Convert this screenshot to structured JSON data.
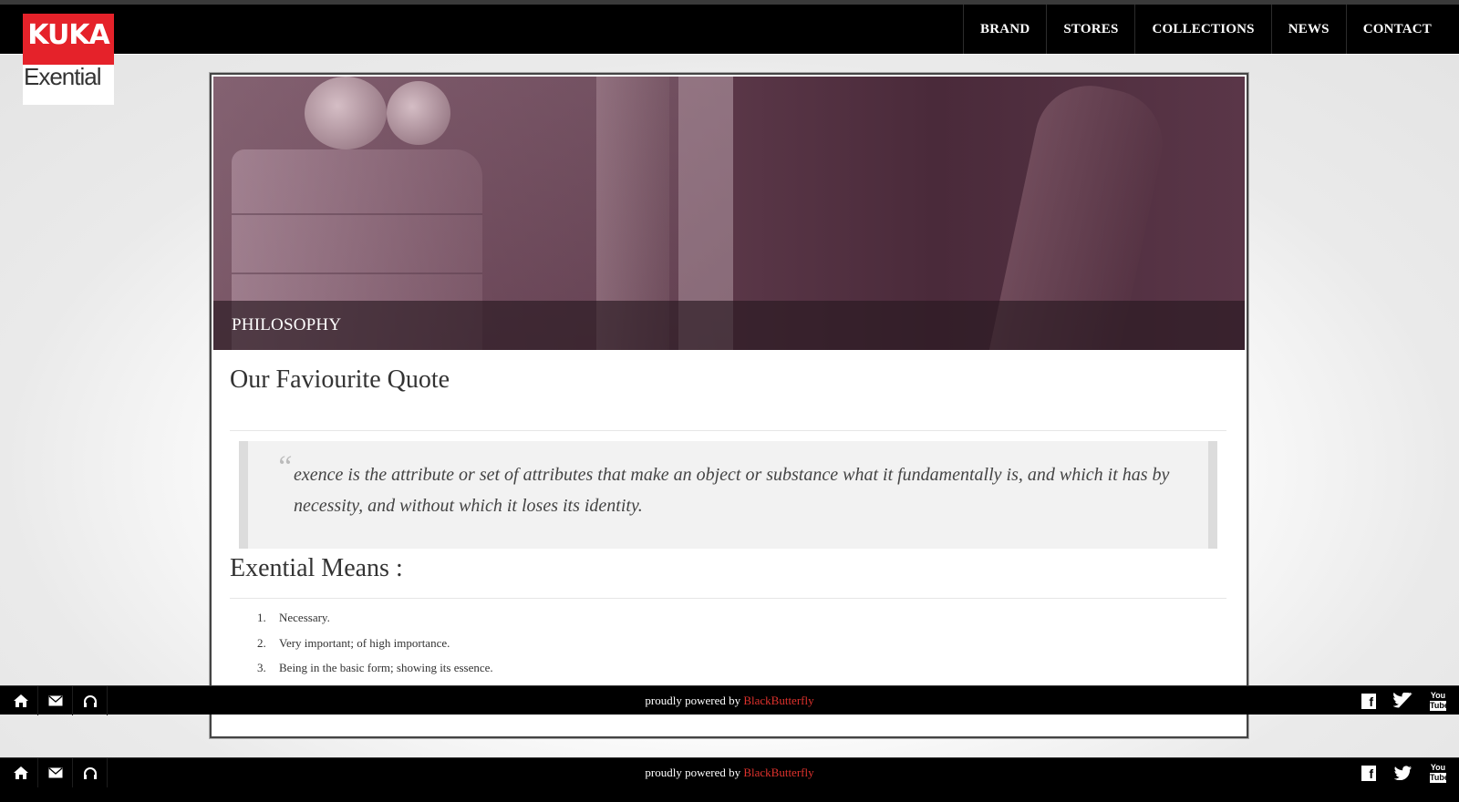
{
  "logo": {
    "top": "KUKA",
    "bottom": "Exential"
  },
  "nav": {
    "items": [
      {
        "label": "BRAND"
      },
      {
        "label": "STORES"
      },
      {
        "label": "COLLECTIONS"
      },
      {
        "label": "NEWS"
      },
      {
        "label": "CONTACT"
      }
    ]
  },
  "hero": {
    "caption": "PHILOSOPHY"
  },
  "content": {
    "quote_heading": "Our Faviourite Quote",
    "quote_mark": "“",
    "quote_text": "exence is the attribute or set of attributes that make an object or substance what it fundamentally is, and which it has by necessity, and without which it loses its identity.",
    "means_heading": "Exential Means :",
    "means": [
      {
        "num": "1.",
        "text": "Necessary."
      },
      {
        "num": "2.",
        "text": "Very important; of high importance."
      },
      {
        "num": "3.",
        "text": "Being in the basic form; showing its essence."
      }
    ]
  },
  "footer": {
    "powered_prefix": "proudly powered by",
    "powered_brand": "BlackButterfly",
    "left_icons": [
      "home-icon",
      "mail-icon",
      "headphones-icon"
    ],
    "right_icons": [
      "facebook-icon",
      "twitter-icon",
      "youtube-icon"
    ],
    "youtube_top": "You",
    "youtube_bottom": "Tube",
    "facebook_letter": "f"
  },
  "colors": {
    "accent": "#e5222a",
    "brand_link": "#e0322d",
    "bar": "#000000"
  }
}
